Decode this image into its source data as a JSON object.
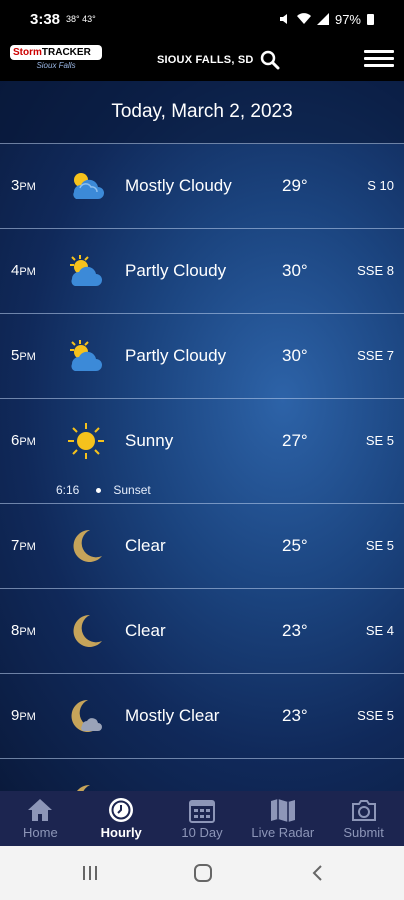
{
  "status_bar": {
    "time": "3:38",
    "temps": "38° 43°",
    "battery": "97%"
  },
  "header": {
    "logo_line1_red": "Storm",
    "logo_line1": "TRACKER",
    "logo_line2": "Sioux Falls",
    "location": "SIOUX FALLS, SD"
  },
  "date": "Today, March 2, 2023",
  "hours": [
    {
      "hour": "3",
      "ampm": "PM",
      "icon": "mostly-cloudy-icon",
      "condition": "Mostly Cloudy",
      "temp": "29°",
      "wind": "S 10"
    },
    {
      "hour": "4",
      "ampm": "PM",
      "icon": "partly-cloudy-icon",
      "condition": "Partly Cloudy",
      "temp": "30°",
      "wind": "SSE 8"
    },
    {
      "hour": "5",
      "ampm": "PM",
      "icon": "partly-cloudy-icon",
      "condition": "Partly Cloudy",
      "temp": "30°",
      "wind": "SSE 7"
    },
    {
      "hour": "6",
      "ampm": "PM",
      "icon": "sun-icon",
      "condition": "Sunny",
      "temp": "27°",
      "wind": "SE 5"
    },
    {
      "hour": "7",
      "ampm": "PM",
      "icon": "moon-icon",
      "condition": "Clear",
      "temp": "25°",
      "wind": "SE 5"
    },
    {
      "hour": "8",
      "ampm": "PM",
      "icon": "moon-icon",
      "condition": "Clear",
      "temp": "23°",
      "wind": "SE 4"
    },
    {
      "hour": "9",
      "ampm": "PM",
      "icon": "moon-cloud-icon",
      "condition": "Mostly Clear",
      "temp": "23°",
      "wind": "SSE 5"
    }
  ],
  "sunset": {
    "time": "6:16",
    "label": "Sunset"
  },
  "nav": {
    "home": "Home",
    "hourly": "Hourly",
    "ten_day": "10 Day",
    "radar": "Live Radar",
    "submit": "Submit"
  },
  "colors": {
    "nav_bg": "#1c2550",
    "content_top": "#0a1a3c",
    "content_mid": "#2d63a8",
    "cloud_blue": "#3c8ad8",
    "sun_yellow": "#f6c21c",
    "moon_gold": "#c6a45a"
  }
}
